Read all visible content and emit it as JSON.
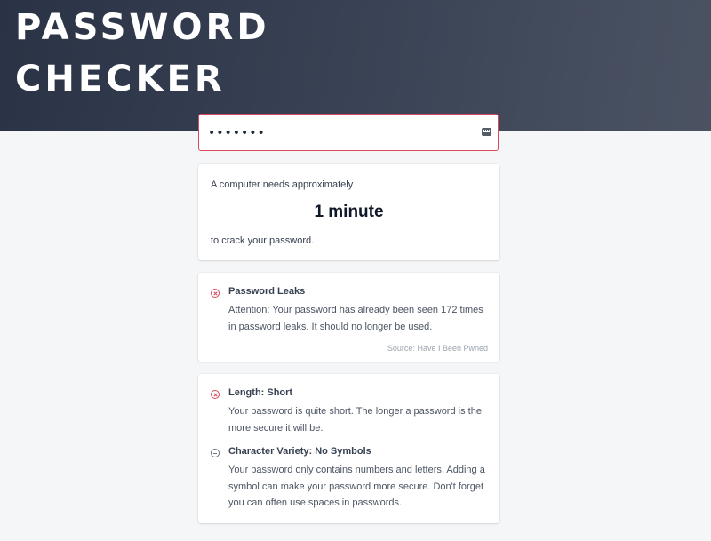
{
  "hero": {
    "title": "PASSWORD\nCHECKER"
  },
  "password_field": {
    "value": "•••••••"
  },
  "crack_time": {
    "intro": "A computer needs approximately",
    "value": "1 minute",
    "outro": "to crack your password."
  },
  "leaks": {
    "title": "Password Leaks",
    "text": "Attention: Your password has already been seen 172 times in password leaks. It should no longer be used.",
    "source": "Source: Have I Been Pwned",
    "status": "fail"
  },
  "checks": [
    {
      "title": "Length: Short",
      "text": "Your password is quite short. The longer a password is the more secure it will be.",
      "status": "fail"
    },
    {
      "title": "Character Variety: No Symbols",
      "text": "Your password only contains numbers and letters. Adding a symbol can make your password more secure. Don't forget you can often use spaces in passwords.",
      "status": "neutral"
    }
  ],
  "colors": {
    "accent_error": "#d6485a",
    "hero_dark": "#2a3345",
    "neutral_icon": "#6b7280"
  }
}
